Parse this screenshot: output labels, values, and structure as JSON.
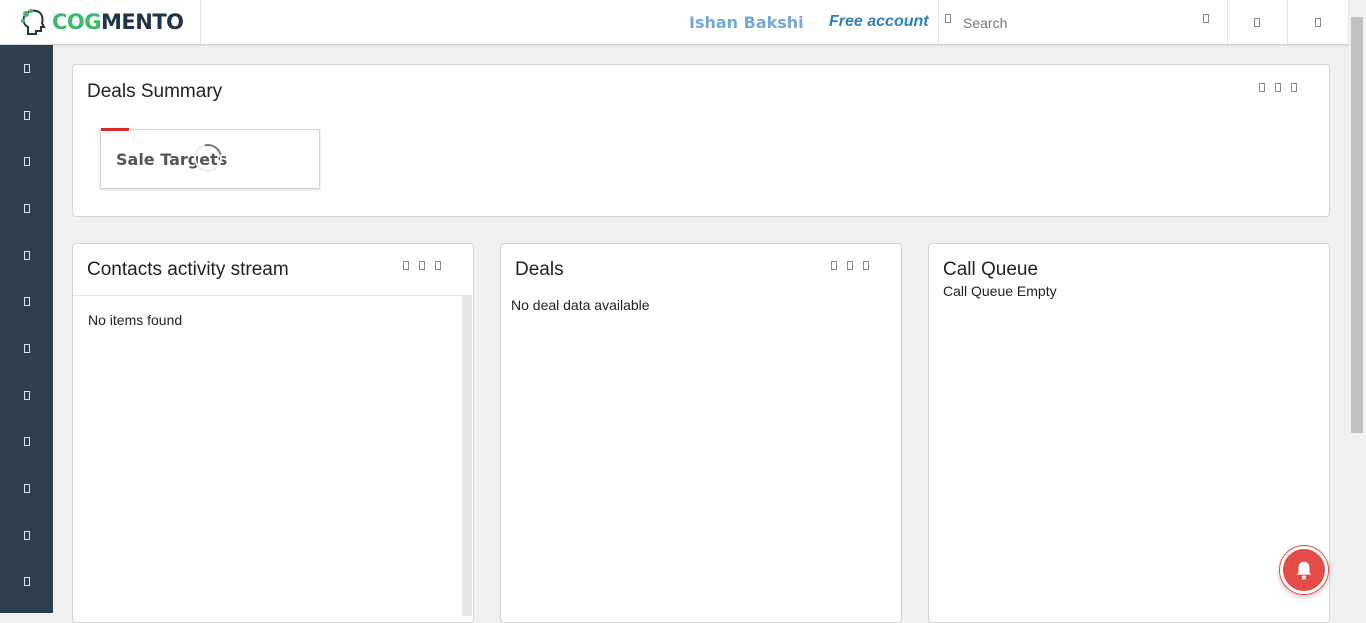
{
  "header": {
    "brand_part1": "COG",
    "brand_part2": "MENTO",
    "user_name": "Ishan Bakshi",
    "account_type": "Free account",
    "search_placeholder": "Search"
  },
  "sidebar": {
    "item_count": 12
  },
  "deals_summary": {
    "title": "Deals Summary",
    "target_label": "Sale Targets"
  },
  "contacts_stream": {
    "title": "Contacts activity stream",
    "empty_text": "No items found"
  },
  "deals": {
    "title": "Deals",
    "empty_text": "No deal data available"
  },
  "call_queue": {
    "title": "Call Queue",
    "empty_text": "Call Queue Empty"
  },
  "colors": {
    "sidebar_bg": "#2c3e50",
    "brand_green": "#3dba6b",
    "brand_dark": "#203549",
    "user_name": "#76a9d8",
    "account_type": "#2d7fbf",
    "notification": "#e54b47",
    "target_accent": "#db2828"
  },
  "icons": {
    "logo": "head-gear-icon",
    "notification": "bell-icon",
    "search": "search-icon",
    "card_tools": [
      "cog-icon",
      "refresh-icon",
      "close-icon"
    ]
  }
}
